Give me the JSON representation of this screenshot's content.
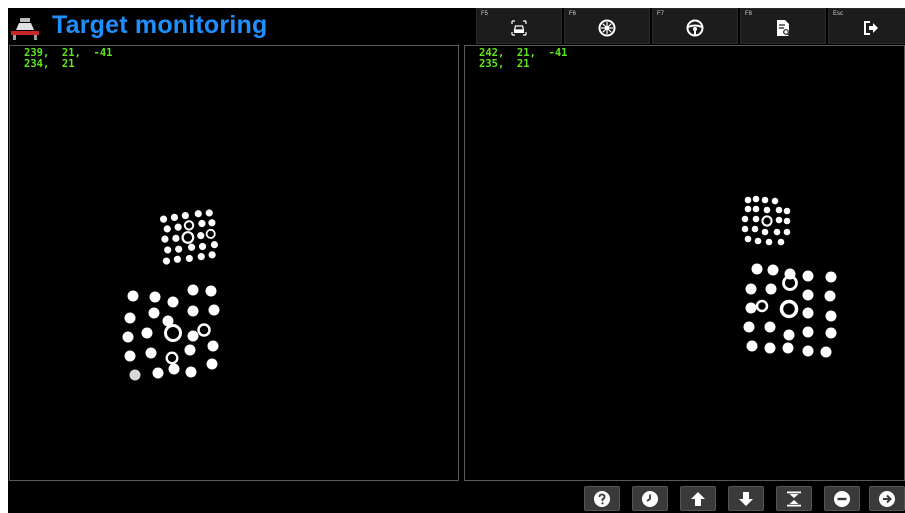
{
  "header": {
    "title": "Target monitoring",
    "function_keys": [
      {
        "key": "F5",
        "icon": "vehicle-scan-icon"
      },
      {
        "key": "F6",
        "icon": "wheel-icon"
      },
      {
        "key": "F7",
        "icon": "steering-wheel-icon"
      },
      {
        "key": "F8",
        "icon": "report-icon"
      },
      {
        "key": "Esc",
        "icon": "exit-icon"
      }
    ]
  },
  "left_camera": {
    "line1": "239,  21,  -41",
    "line2": "234,  21"
  },
  "right_camera": {
    "line1": "242,  21,  -41",
    "line2": "235,  21"
  },
  "toolbar": {
    "buttons": [
      "help-icon",
      "clock-icon",
      "arrow-up-icon",
      "arrow-down-icon",
      "fit-vertical-icon",
      "zoom-out-icon",
      "next-icon"
    ]
  },
  "colors": {
    "title": "#1f8fff",
    "readout": "#5ee81d",
    "background": "#000000"
  }
}
